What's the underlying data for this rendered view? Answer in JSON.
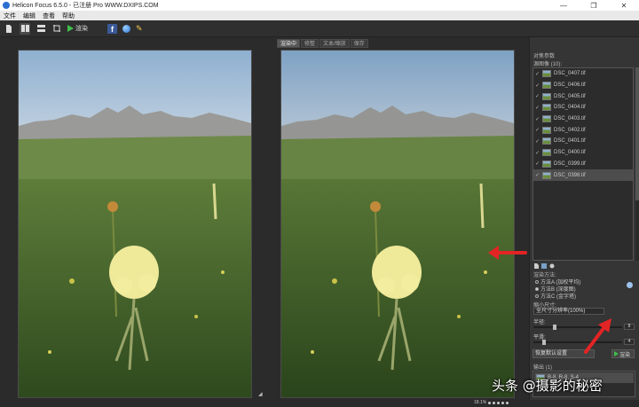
{
  "window": {
    "title": "Helicon Focus 6.5.0 - 已注册 Pro  WWW.DXIPS.COM"
  },
  "menu": [
    "文件",
    "编辑",
    "查看",
    "帮助"
  ],
  "toolbar": {
    "render_label": "渲染"
  },
  "view_tabs": [
    {
      "label": "渲染中",
      "active": true
    },
    {
      "label": "修整",
      "active": false
    },
    {
      "label": "文本/缩放",
      "active": false
    },
    {
      "label": "保存",
      "active": false
    }
  ],
  "panel": {
    "header": "对焦参数",
    "source_files_label": "源图像 (10):",
    "files": [
      {
        "name": "DSC_0407.tif",
        "selected": false
      },
      {
        "name": "DSC_0406.tif",
        "selected": false
      },
      {
        "name": "DSC_0405.tif",
        "selected": false
      },
      {
        "name": "DSC_0404.tif",
        "selected": false
      },
      {
        "name": "DSC_0403.tif",
        "selected": false
      },
      {
        "name": "DSC_0402.tif",
        "selected": false
      },
      {
        "name": "DSC_0401.tif",
        "selected": false
      },
      {
        "name": "DSC_0400.tif",
        "selected": false
      },
      {
        "name": "DSC_0399.tif",
        "selected": false
      },
      {
        "name": "DSC_0398.tif",
        "selected": true
      }
    ],
    "method_label": "渲染方法:",
    "methods": [
      {
        "label": "方法A (加权平均)",
        "selected": false
      },
      {
        "label": "方法B (深度图)",
        "selected": true
      },
      {
        "label": "方法C (金字塔)",
        "selected": false
      }
    ],
    "resize_label": "缩小尺寸:",
    "resize_value": "全尺寸分辨率(100%)",
    "radius_label": "半径:",
    "radius_value": "8",
    "smoothing_label": "平滑:",
    "smoothing_value": "4",
    "reset_label": "恢复默认设置",
    "render_label": "渲染",
    "output_label": "输出 (1)",
    "output_item": "B-8, R-8, S-4"
  },
  "status": {
    "zoom": "18.1%"
  },
  "watermark": "头条 @摄影的秘密",
  "colors": {
    "arrow": "#e32424",
    "selection": "#4d4d4d"
  }
}
